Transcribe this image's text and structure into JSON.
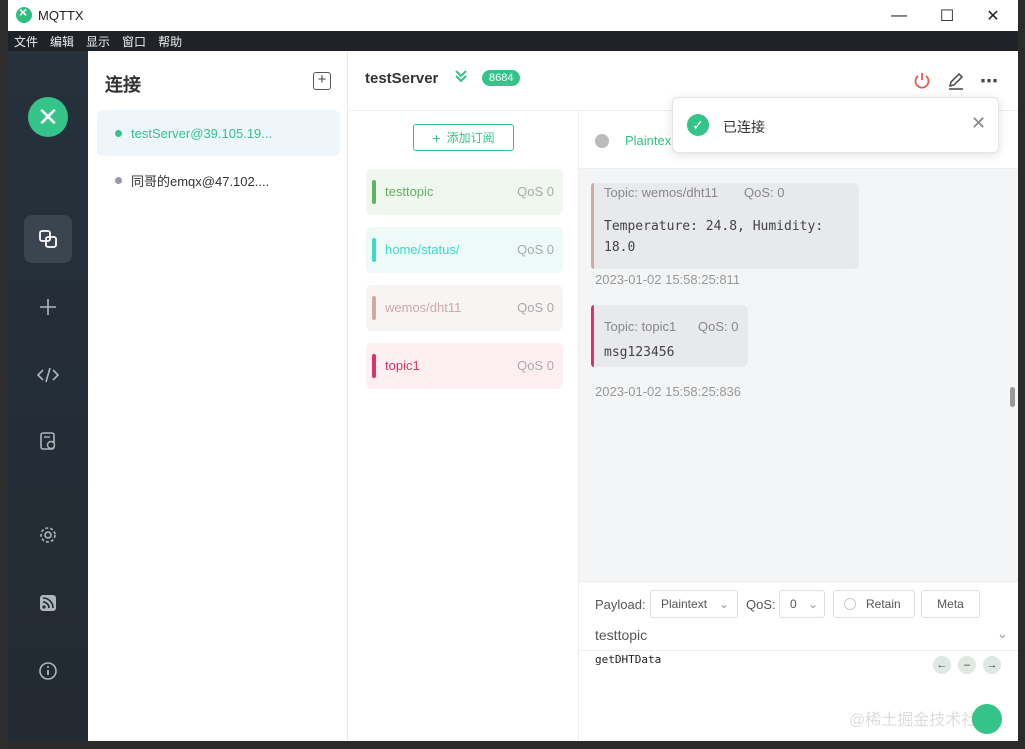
{
  "window": {
    "title": "MQTTX",
    "min": "—",
    "max": "☐",
    "close": "✕"
  },
  "menu": [
    "文件",
    "编辑",
    "显示",
    "窗口",
    "帮助"
  ],
  "nav": {
    "logo": "✕"
  },
  "connections": {
    "title": "连接",
    "items": [
      {
        "name": "testServer@39.105.19...",
        "status_color": "#34c388",
        "active": true
      },
      {
        "name": "同哥的emqx@47.102....",
        "status_color": "#9a9aa5",
        "active": false
      }
    ]
  },
  "header": {
    "server": "testServer",
    "count": "8684"
  },
  "subscriptions": {
    "add_label": "添加订阅",
    "items": [
      {
        "topic": "testtopic",
        "qos": "QoS 0",
        "color": "#5fb35f",
        "bg": "#f0f7ef"
      },
      {
        "topic": "home/status/",
        "qos": "QoS 0",
        "color": "#3dd9c9",
        "bg": "#eefaf8"
      },
      {
        "topic": "wemos/dht11",
        "qos": "QoS 0",
        "color": "#d0a9a4",
        "bg": "#f8f4f3"
      },
      {
        "topic": "topic1",
        "qos": "QoS 0",
        "color": "#d8336a",
        "bg": "#fdeff2"
      }
    ]
  },
  "messages": {
    "format": "Plaintex",
    "items": [
      {
        "topic": "Topic: wemos/dht11",
        "qos": "QoS: 0",
        "payload": [
          "Temperature: 24.8, Humidity:",
          "18.0"
        ],
        "time": "2023-01-02 15:58:25:811",
        "color": "#d0a9a4"
      },
      {
        "topic": "Topic: topic1",
        "qos": "QoS: 0",
        "payload": [
          "msg123456"
        ],
        "time": "2023-01-02 15:58:25:836",
        "color": "#d8336a"
      }
    ]
  },
  "toast": {
    "text": "已连接"
  },
  "publish": {
    "payload_label": "Payload:",
    "payload_format": "Plaintext",
    "qos_label": "QoS:",
    "qos_value": "0",
    "retain_label": "Retain",
    "meta_label": "Meta",
    "topic": "testtopic",
    "payload": "getDHTData"
  },
  "watermark": "@稀土掘金技术社区"
}
